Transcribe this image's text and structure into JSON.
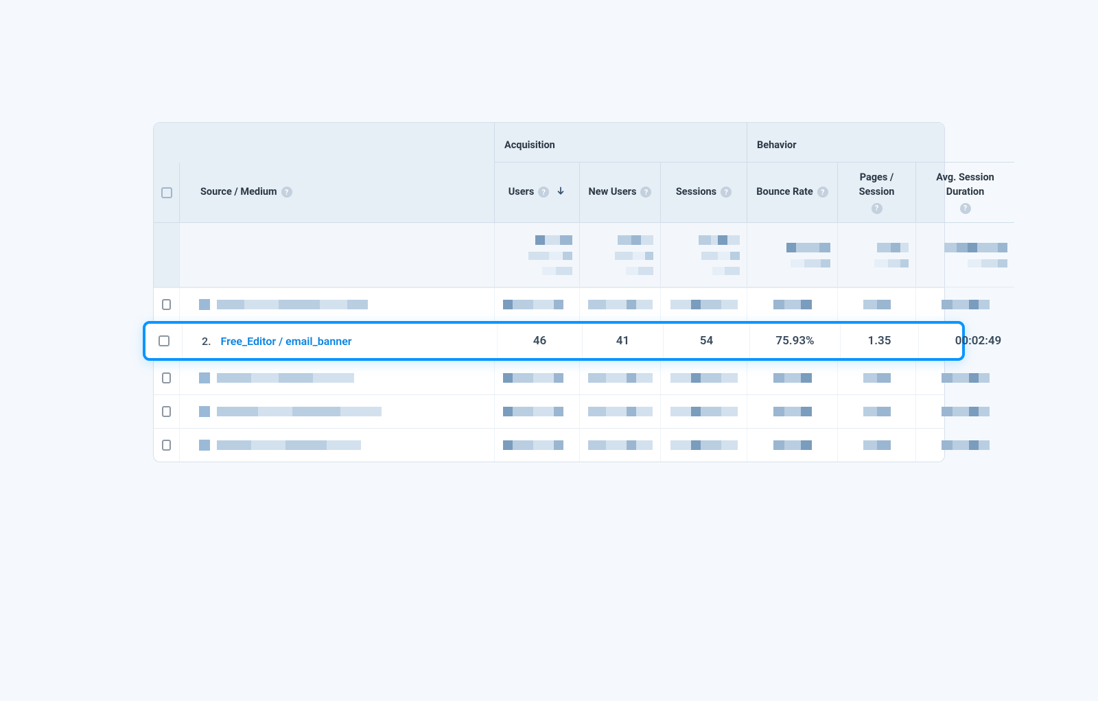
{
  "table": {
    "dimension_label": "Source / Medium",
    "groups": {
      "acquisition": "Acquisition",
      "behavior": "Behavior"
    },
    "columns": {
      "users": "Users",
      "new_users": "New Users",
      "sessions": "Sessions",
      "bounce_rate": "Bounce Rate",
      "pages_session": "Pages / Session",
      "avg_session": "Avg. Session Duration"
    },
    "sorted_by": "users",
    "highlighted_row": {
      "index": "2.",
      "source_medium": "Free_Editor / email_banner",
      "users": "46",
      "new_users": "41",
      "sessions": "54",
      "bounce_rate": "75.93%",
      "pages_session": "1.35",
      "avg_session": "00:02:49"
    }
  }
}
